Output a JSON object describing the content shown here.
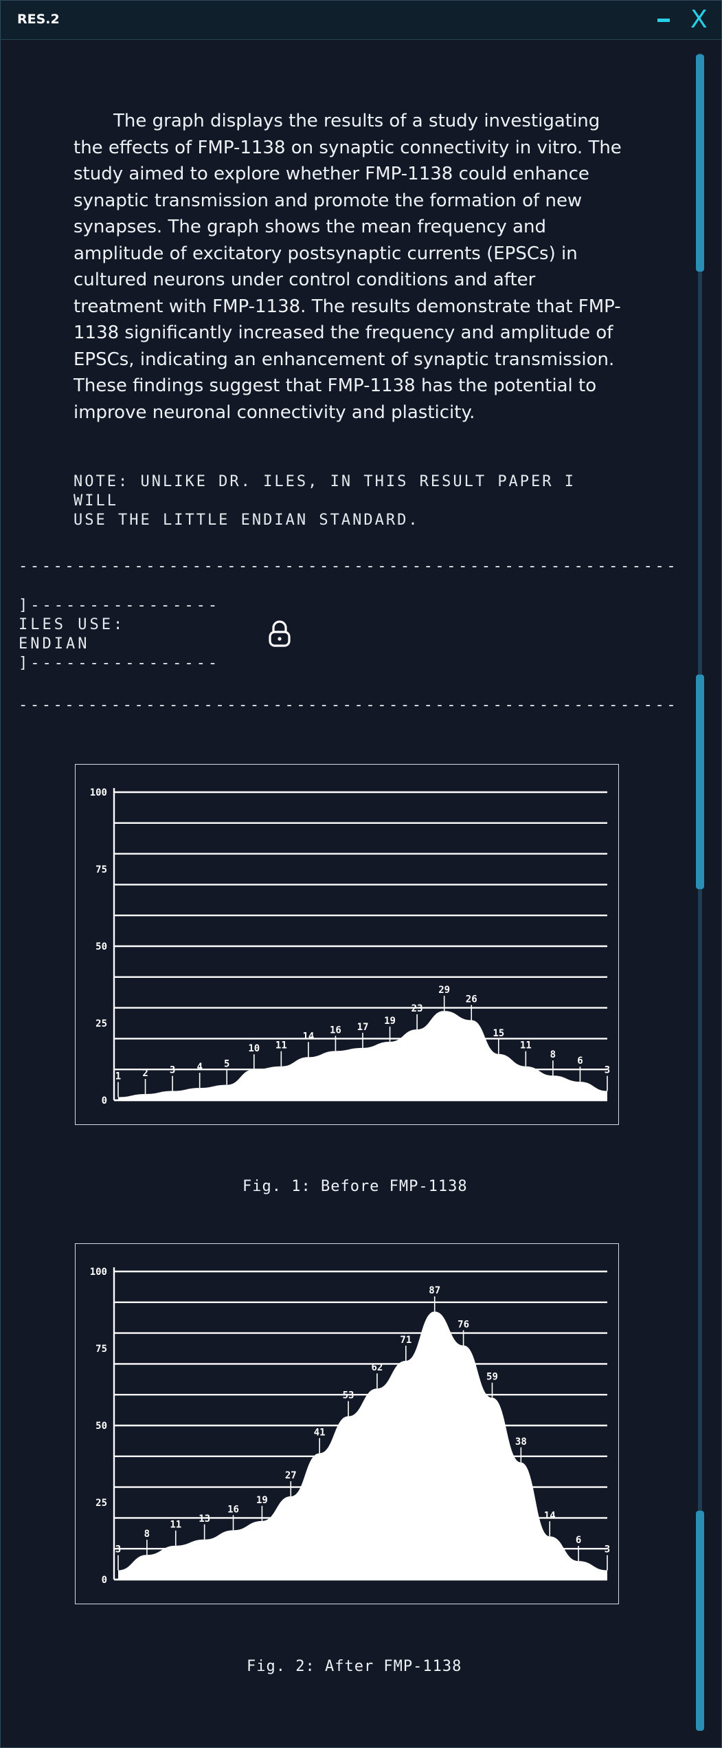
{
  "window": {
    "title": "RES.2",
    "minimize_label": "–",
    "close_label": "X"
  },
  "body": {
    "paragraph": "The graph displays the results of a study investigating the effects of FMP-1138 on synaptic connectivity in vitro. The study aimed to explore whether FMP-1138 could enhance synaptic transmission and promote the formation of new synapses. The graph shows the mean frequency and amplitude of excitatory postsynaptic currents (EPSCs) in cultured neurons under control conditions and after treatment with FMP-1138. The results demonstrate that FMP-1138 significantly increased the frequency and amplitude of EPSCs, indicating an enhancement of synaptic transmission. These findings suggest that FMP-1138 has the potential to improve neuronal connectivity and plasticity.",
    "note": "NOTE: UNLIKE DR. ILES, IN THIS RESULT PAPER I WILL\nUSE THE LITTLE ENDIAN STANDARD.",
    "divider": "------------------------------------------------------------",
    "locked_block": "]----------------\nILES USE:\nENDIAN\n]----------------",
    "lock_icon": "padlock-icon"
  },
  "chart_data": [
    {
      "type": "area",
      "title": "",
      "caption": "Fig. 1: Before FMP-1138",
      "ylim": [
        0,
        100
      ],
      "y_ticks": [
        0,
        25,
        50,
        75,
        100
      ],
      "grid": true,
      "values": [
        1,
        2,
        3,
        4,
        5,
        10,
        11,
        14,
        16,
        17,
        19,
        23,
        29,
        26,
        15,
        11,
        8,
        6,
        3
      ]
    },
    {
      "type": "area",
      "title": "",
      "caption": "Fig. 2: After FMP-1138",
      "ylim": [
        0,
        100
      ],
      "y_ticks": [
        0,
        25,
        50,
        75,
        100
      ],
      "grid": true,
      "values": [
        3,
        8,
        11,
        13,
        16,
        19,
        27,
        41,
        53,
        62,
        71,
        87,
        76,
        59,
        38,
        14,
        6,
        3
      ]
    }
  ],
  "colors": {
    "background": "#121826",
    "accent": "#27d0e6",
    "scrollbar": "#2a8fb5",
    "chart_fill": "#ffffff"
  }
}
